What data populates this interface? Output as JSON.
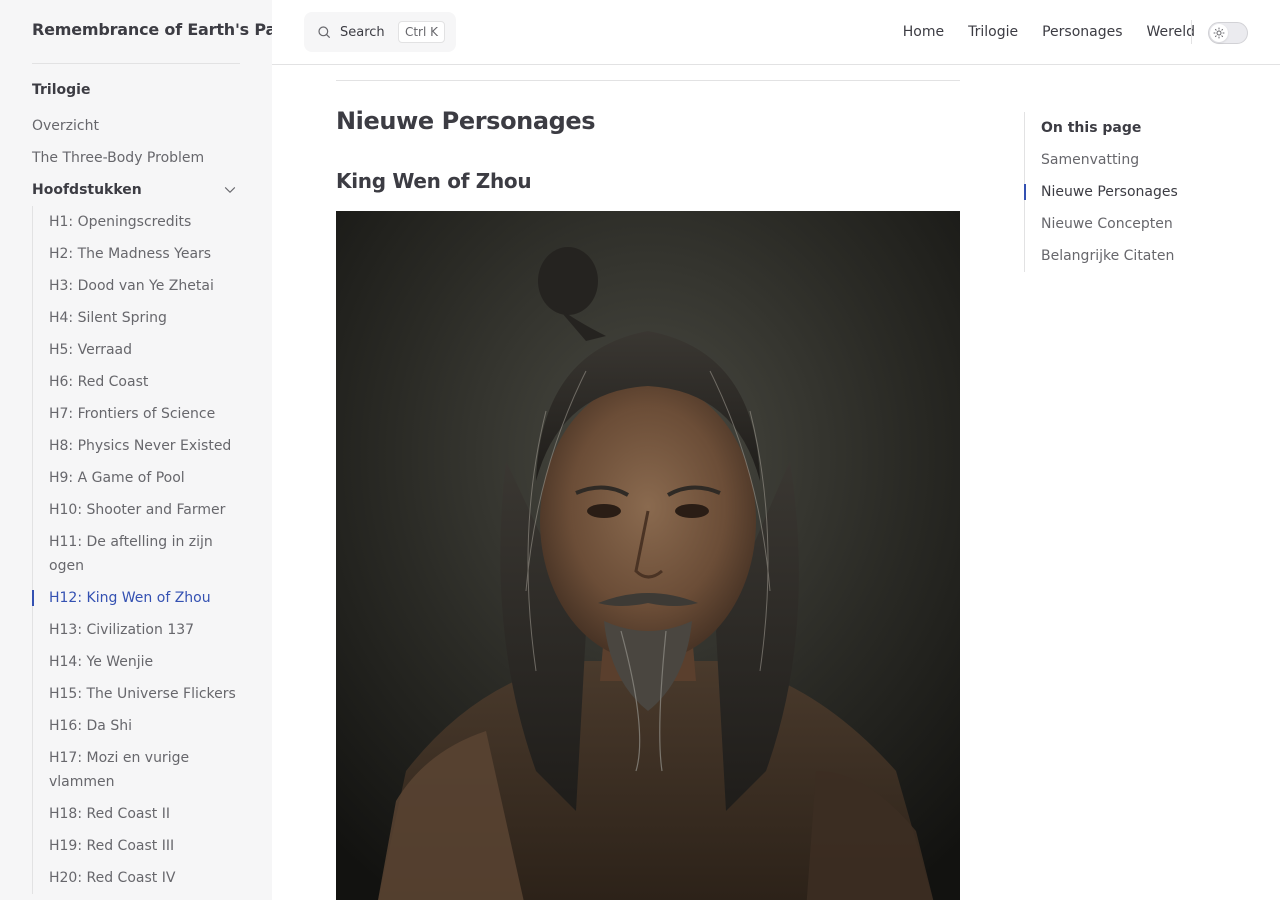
{
  "site": {
    "title": "Remembrance of Earth's Past Wiki"
  },
  "search": {
    "label": "Search",
    "shortcut": "Ctrl K"
  },
  "topnav": {
    "items": [
      "Home",
      "Trilogie",
      "Personages",
      "Wereld"
    ]
  },
  "sidebar": {
    "section_title": "Trilogie",
    "items": [
      "Overzicht",
      "The Three-Body Problem"
    ],
    "group_label": "Hoofdstukken",
    "chapters": [
      "H1: Openingscredits",
      "H2: The Madness Years",
      "H3: Dood van Ye Zhetai",
      "H4: Silent Spring",
      "H5: Verraad",
      "H6: Red Coast",
      "H7: Frontiers of Science",
      "H8: Physics Never Existed",
      "H9: A Game of Pool",
      "H10: Shooter and Farmer",
      "H11: De aftelling in zijn ogen",
      "H12: King Wen of Zhou",
      "H13: Civilization 137",
      "H14: Ye Wenjie",
      "H15: The Universe Flickers",
      "H16: Da Shi",
      "H17: Mozi en vurige vlammen",
      "H18: Red Coast II",
      "H19: Red Coast III",
      "H20: Red Coast IV"
    ],
    "active_chapter_index": 11
  },
  "main": {
    "section_heading": "Nieuwe Personages",
    "subheading": "King Wen of Zhou"
  },
  "outline": {
    "title": "On this page",
    "items": [
      "Samenvatting",
      "Nieuwe Personages",
      "Nieuwe Concepten",
      "Belangrijke Citaten"
    ],
    "active_index": 1
  },
  "colors": {
    "accent": "#3451b2",
    "sidebar_bg": "#f6f6f7",
    "text": "#3c3c43",
    "muted": "#67676c",
    "divider": "#e2e2e3"
  }
}
